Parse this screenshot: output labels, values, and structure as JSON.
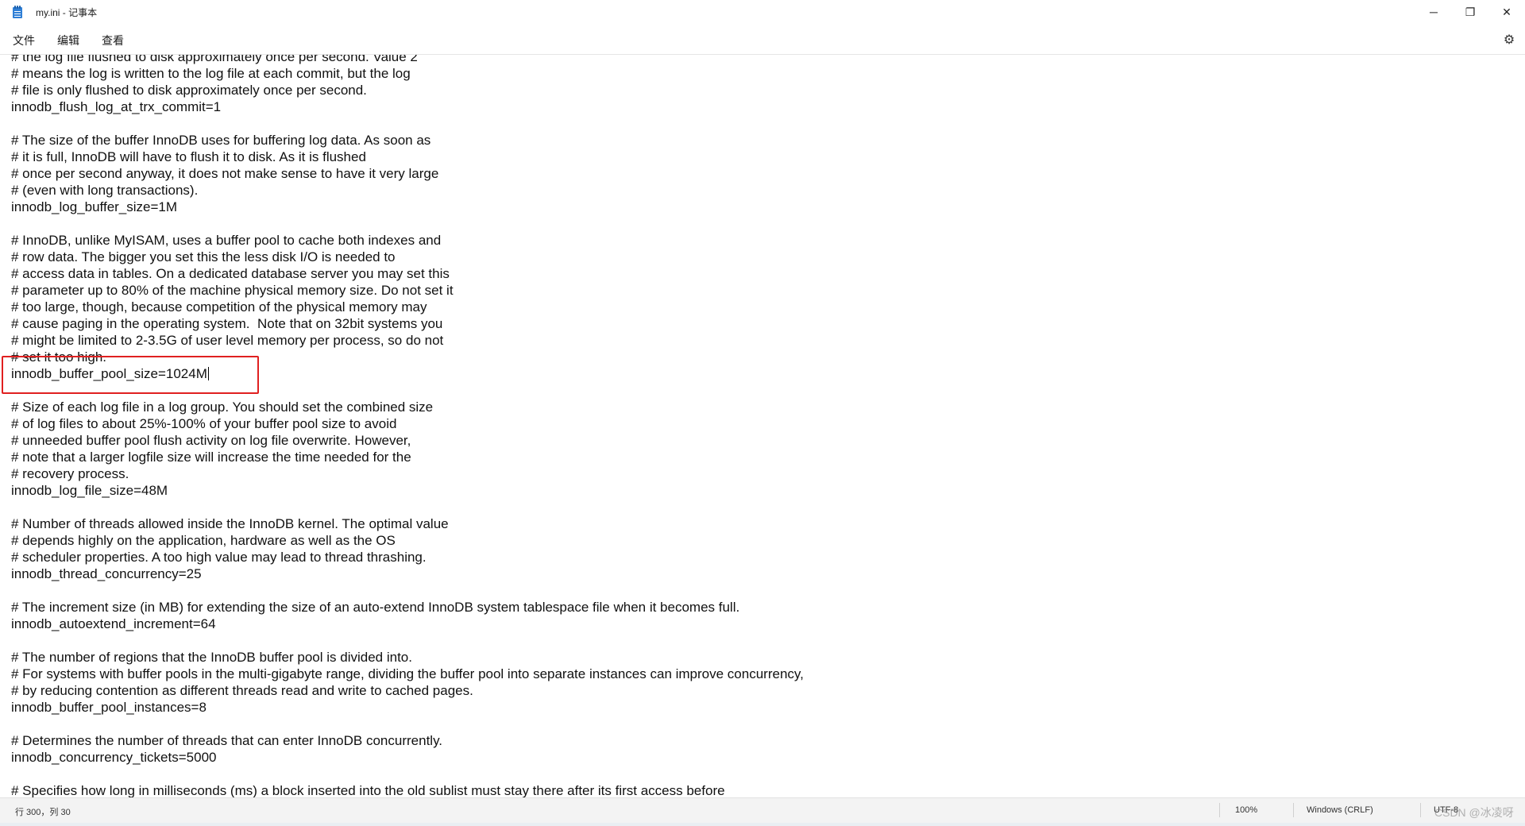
{
  "window": {
    "title": "my.ini - 记事本",
    "minimize_glyph": "─",
    "restore_glyph": "❐",
    "close_glyph": "✕"
  },
  "menu": {
    "file": "文件",
    "edit": "编辑",
    "view": "查看"
  },
  "settings_glyph": "⚙",
  "editor": {
    "lines": [
      "# the log file flushed to disk approximately once per second. Value 2",
      "# means the log is written to the log file at each commit, but the log",
      "# file is only flushed to disk approximately once per second.",
      "innodb_flush_log_at_trx_commit=1",
      "",
      "# The size of the buffer InnoDB uses for buffering log data. As soon as",
      "# it is full, InnoDB will have to flush it to disk. As it is flushed",
      "# once per second anyway, it does not make sense to have it very large",
      "# (even with long transactions).",
      "innodb_log_buffer_size=1M",
      "",
      "# InnoDB, unlike MyISAM, uses a buffer pool to cache both indexes and",
      "# row data. The bigger you set this the less disk I/O is needed to",
      "# access data in tables. On a dedicated database server you may set this",
      "# parameter up to 80% of the machine physical memory size. Do not set it",
      "# too large, though, because competition of the physical memory may",
      "# cause paging in the operating system.  Note that on 32bit systems you",
      "# might be limited to 2-3.5G of user level memory per process, so do not",
      "# set it too high.",
      "innodb_buffer_pool_size=1024M",
      "",
      "# Size of each log file in a log group. You should set the combined size",
      "# of log files to about 25%-100% of your buffer pool size to avoid",
      "# unneeded buffer pool flush activity on log file overwrite. However,",
      "# note that a larger logfile size will increase the time needed for the",
      "# recovery process.",
      "innodb_log_file_size=48M",
      "",
      "# Number of threads allowed inside the InnoDB kernel. The optimal value",
      "# depends highly on the application, hardware as well as the OS",
      "# scheduler properties. A too high value may lead to thread thrashing.",
      "innodb_thread_concurrency=25",
      "",
      "# The increment size (in MB) for extending the size of an auto-extend InnoDB system tablespace file when it becomes full.",
      "innodb_autoextend_increment=64",
      "",
      "# The number of regions that the InnoDB buffer pool is divided into.",
      "# For systems with buffer pools in the multi-gigabyte range, dividing the buffer pool into separate instances can improve concurrency,",
      "# by reducing contention as different threads read and write to cached pages.",
      "innodb_buffer_pool_instances=8",
      "",
      "# Determines the number of threads that can enter InnoDB concurrently.",
      "innodb_concurrency_tickets=5000",
      "",
      "# Specifies how long in milliseconds (ms) a block inserted into the old sublist must stay there after its first access before"
    ]
  },
  "status": {
    "position": "行 300，列 30",
    "zoom": "100%",
    "line_ending": "Windows (CRLF)",
    "encoding": "UTF-8"
  },
  "watermark": "CSDN @冰凌呀"
}
